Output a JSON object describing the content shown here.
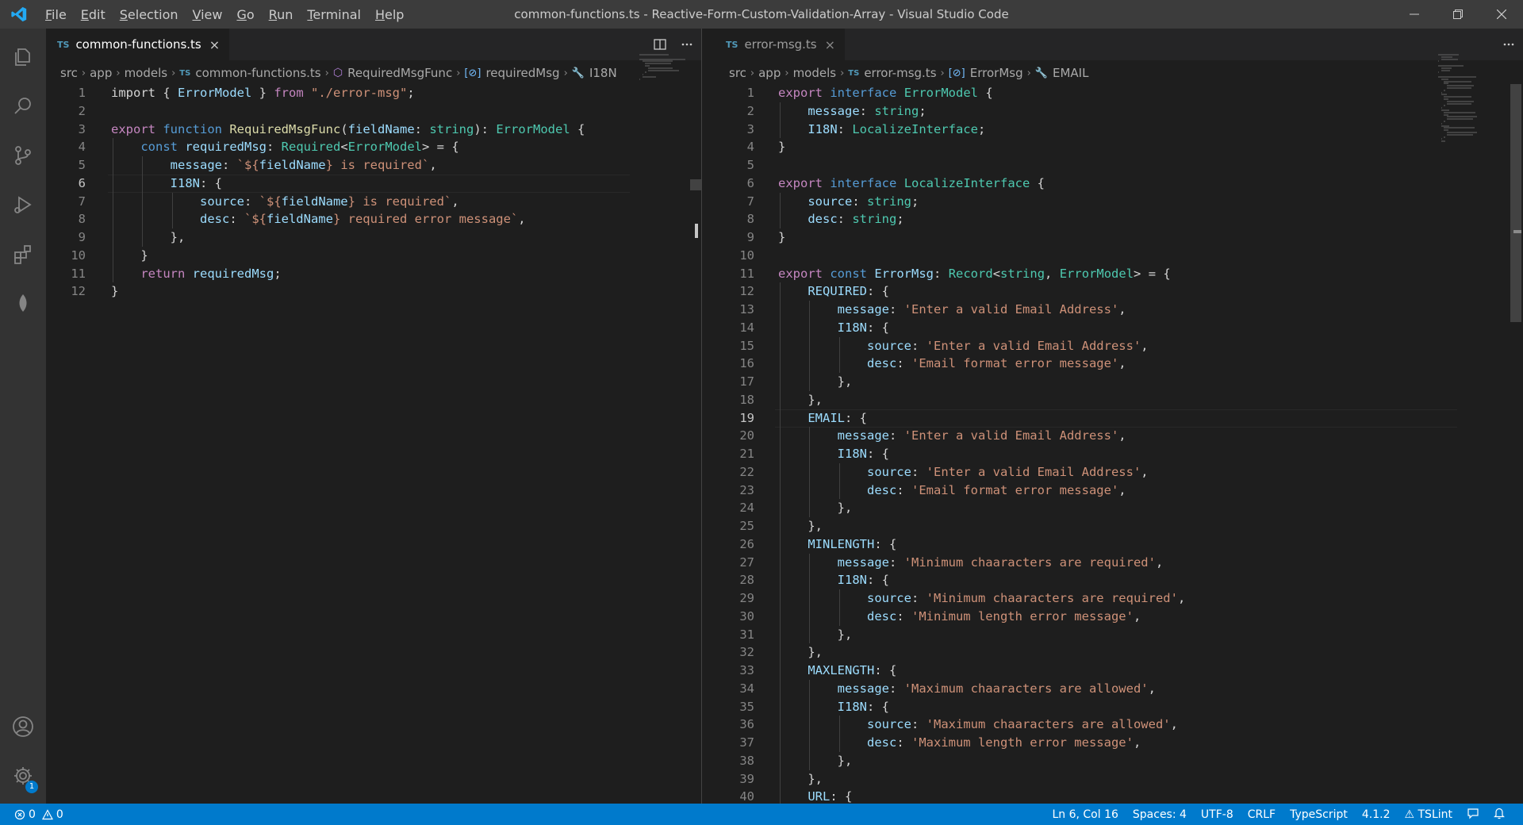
{
  "window": {
    "title": "common-functions.ts - Reactive-Form-Custom-Validation-Array - Visual Studio Code",
    "menu": [
      "File",
      "Edit",
      "Selection",
      "View",
      "Go",
      "Run",
      "Terminal",
      "Help"
    ]
  },
  "activity": {
    "items": [
      "explorer-icon",
      "search-icon",
      "source-control-icon",
      "run-debug-icon",
      "extensions-icon",
      "mongodb-leaf-icon"
    ],
    "bottom": [
      "account-icon",
      "settings-gear-icon"
    ],
    "settings_badge": "1"
  },
  "left_editor": {
    "tab": {
      "badge": "TS",
      "label": "common-functions.ts",
      "close": "×"
    },
    "actions": [
      "split-editor-icon",
      "more-actions-icon"
    ],
    "breadcrumb": [
      "src",
      "app",
      "models",
      "common-functions.ts",
      "RequiredMsgFunc",
      "requiredMsg",
      "I18N"
    ],
    "current_line": "6",
    "lines": [
      {
        "n": "1",
        "tokens": [
          [
            "pu",
            "import { "
          ],
          [
            "va",
            "ErrorModel"
          ],
          [
            "pu",
            " } "
          ],
          [
            "kc",
            "from"
          ],
          [
            "pu",
            " "
          ],
          [
            "st",
            "\"./error-msg\""
          ],
          [
            "pu",
            ";"
          ]
        ]
      },
      {
        "n": "2",
        "tokens": []
      },
      {
        "n": "3",
        "tokens": [
          [
            "kc",
            "export"
          ],
          [
            "pu",
            " "
          ],
          [
            "kw",
            "function"
          ],
          [
            "pu",
            " "
          ],
          [
            "fn",
            "RequiredMsgFunc"
          ],
          [
            "pu",
            "("
          ],
          [
            "va",
            "fieldName"
          ],
          [
            "pu",
            ": "
          ],
          [
            "ty",
            "string"
          ],
          [
            "pu",
            "): "
          ],
          [
            "ty",
            "ErrorModel"
          ],
          [
            "pu",
            " {"
          ]
        ]
      },
      {
        "n": "4",
        "tokens": [
          [
            "pu",
            "    "
          ],
          [
            "kw",
            "const"
          ],
          [
            "pu",
            " "
          ],
          [
            "va",
            "requiredMsg"
          ],
          [
            "pu",
            ": "
          ],
          [
            "ty",
            "Required"
          ],
          [
            "pu",
            "<"
          ],
          [
            "ty",
            "ErrorModel"
          ],
          [
            "pu",
            "> = {"
          ]
        ]
      },
      {
        "n": "5",
        "tokens": [
          [
            "pu",
            "        "
          ],
          [
            "va",
            "message"
          ],
          [
            "pu",
            ": "
          ],
          [
            "st",
            "`${"
          ],
          [
            "va",
            "fieldName"
          ],
          [
            "st",
            "} is required`"
          ],
          [
            "pu",
            ","
          ]
        ]
      },
      {
        "n": "6",
        "tokens": [
          [
            "pu",
            "        "
          ],
          [
            "va",
            "I18N"
          ],
          [
            "pu",
            ": {"
          ]
        ]
      },
      {
        "n": "7",
        "tokens": [
          [
            "pu",
            "            "
          ],
          [
            "va",
            "source"
          ],
          [
            "pu",
            ": "
          ],
          [
            "st",
            "`${"
          ],
          [
            "va",
            "fieldName"
          ],
          [
            "st",
            "} is required`"
          ],
          [
            "pu",
            ","
          ]
        ]
      },
      {
        "n": "8",
        "tokens": [
          [
            "pu",
            "            "
          ],
          [
            "va",
            "desc"
          ],
          [
            "pu",
            ": "
          ],
          [
            "st",
            "`${"
          ],
          [
            "va",
            "fieldName"
          ],
          [
            "st",
            "} required error message`"
          ],
          [
            "pu",
            ","
          ]
        ]
      },
      {
        "n": "9",
        "tokens": [
          [
            "pu",
            "        },"
          ]
        ]
      },
      {
        "n": "10",
        "tokens": [
          [
            "pu",
            "    }"
          ]
        ]
      },
      {
        "n": "11",
        "tokens": [
          [
            "pu",
            "    "
          ],
          [
            "kc",
            "return"
          ],
          [
            "pu",
            " "
          ],
          [
            "va",
            "requiredMsg"
          ],
          [
            "pu",
            ";"
          ]
        ]
      },
      {
        "n": "12",
        "tokens": [
          [
            "pu",
            "}"
          ]
        ]
      }
    ]
  },
  "right_editor": {
    "tab": {
      "badge": "TS",
      "label": "error-msg.ts",
      "close": "×"
    },
    "actions": [
      "more-actions-icon"
    ],
    "breadcrumb": [
      "src",
      "app",
      "models",
      "error-msg.ts",
      "ErrorMsg",
      "EMAIL"
    ],
    "current_line": "19",
    "lines": [
      {
        "n": "1",
        "tokens": [
          [
            "kc",
            "export"
          ],
          [
            "pu",
            " "
          ],
          [
            "kw",
            "interface"
          ],
          [
            "pu",
            " "
          ],
          [
            "ty",
            "ErrorModel"
          ],
          [
            "pu",
            " {"
          ]
        ]
      },
      {
        "n": "2",
        "tokens": [
          [
            "pu",
            "    "
          ],
          [
            "va",
            "message"
          ],
          [
            "pu",
            ": "
          ],
          [
            "ty",
            "string"
          ],
          [
            "pu",
            ";"
          ]
        ]
      },
      {
        "n": "3",
        "tokens": [
          [
            "pu",
            "    "
          ],
          [
            "va",
            "I18N"
          ],
          [
            "pu",
            ": "
          ],
          [
            "ty",
            "LocalizeInterface"
          ],
          [
            "pu",
            ";"
          ]
        ]
      },
      {
        "n": "4",
        "tokens": [
          [
            "pu",
            "}"
          ]
        ]
      },
      {
        "n": "5",
        "tokens": []
      },
      {
        "n": "6",
        "tokens": [
          [
            "kc",
            "export"
          ],
          [
            "pu",
            " "
          ],
          [
            "kw",
            "interface"
          ],
          [
            "pu",
            " "
          ],
          [
            "ty",
            "LocalizeInterface"
          ],
          [
            "pu",
            " {"
          ]
        ]
      },
      {
        "n": "7",
        "tokens": [
          [
            "pu",
            "    "
          ],
          [
            "va",
            "source"
          ],
          [
            "pu",
            ": "
          ],
          [
            "ty",
            "string"
          ],
          [
            "pu",
            ";"
          ]
        ]
      },
      {
        "n": "8",
        "tokens": [
          [
            "pu",
            "    "
          ],
          [
            "va",
            "desc"
          ],
          [
            "pu",
            ": "
          ],
          [
            "ty",
            "string"
          ],
          [
            "pu",
            ";"
          ]
        ]
      },
      {
        "n": "9",
        "tokens": [
          [
            "pu",
            "}"
          ]
        ]
      },
      {
        "n": "10",
        "tokens": []
      },
      {
        "n": "11",
        "tokens": [
          [
            "kc",
            "export"
          ],
          [
            "pu",
            " "
          ],
          [
            "kw",
            "const"
          ],
          [
            "pu",
            " "
          ],
          [
            "va",
            "ErrorMsg"
          ],
          [
            "pu",
            ": "
          ],
          [
            "ty",
            "Record"
          ],
          [
            "pu",
            "<"
          ],
          [
            "ty",
            "string"
          ],
          [
            "pu",
            ", "
          ],
          [
            "ty",
            "ErrorModel"
          ],
          [
            "pu",
            "> = {"
          ]
        ]
      },
      {
        "n": "12",
        "tokens": [
          [
            "pu",
            "    "
          ],
          [
            "va",
            "REQUIRED"
          ],
          [
            "pu",
            ": {"
          ]
        ]
      },
      {
        "n": "13",
        "tokens": [
          [
            "pu",
            "        "
          ],
          [
            "va",
            "message"
          ],
          [
            "pu",
            ": "
          ],
          [
            "st",
            "'Enter a valid Email Address'"
          ],
          [
            "pu",
            ","
          ]
        ]
      },
      {
        "n": "14",
        "tokens": [
          [
            "pu",
            "        "
          ],
          [
            "va",
            "I18N"
          ],
          [
            "pu",
            ": {"
          ]
        ]
      },
      {
        "n": "15",
        "tokens": [
          [
            "pu",
            "            "
          ],
          [
            "va",
            "source"
          ],
          [
            "pu",
            ": "
          ],
          [
            "st",
            "'Enter a valid Email Address'"
          ],
          [
            "pu",
            ","
          ]
        ]
      },
      {
        "n": "16",
        "tokens": [
          [
            "pu",
            "            "
          ],
          [
            "va",
            "desc"
          ],
          [
            "pu",
            ": "
          ],
          [
            "st",
            "'Email format error message'"
          ],
          [
            "pu",
            ","
          ]
        ]
      },
      {
        "n": "17",
        "tokens": [
          [
            "pu",
            "        },"
          ]
        ]
      },
      {
        "n": "18",
        "tokens": [
          [
            "pu",
            "    },"
          ]
        ]
      },
      {
        "n": "19",
        "tokens": [
          [
            "pu",
            "    "
          ],
          [
            "va",
            "EMAIL"
          ],
          [
            "pu",
            ": {"
          ]
        ]
      },
      {
        "n": "20",
        "tokens": [
          [
            "pu",
            "        "
          ],
          [
            "va",
            "message"
          ],
          [
            "pu",
            ": "
          ],
          [
            "st",
            "'Enter a valid Email Address'"
          ],
          [
            "pu",
            ","
          ]
        ]
      },
      {
        "n": "21",
        "tokens": [
          [
            "pu",
            "        "
          ],
          [
            "va",
            "I18N"
          ],
          [
            "pu",
            ": {"
          ]
        ]
      },
      {
        "n": "22",
        "tokens": [
          [
            "pu",
            "            "
          ],
          [
            "va",
            "source"
          ],
          [
            "pu",
            ": "
          ],
          [
            "st",
            "'Enter a valid Email Address'"
          ],
          [
            "pu",
            ","
          ]
        ]
      },
      {
        "n": "23",
        "tokens": [
          [
            "pu",
            "            "
          ],
          [
            "va",
            "desc"
          ],
          [
            "pu",
            ": "
          ],
          [
            "st",
            "'Email format error message'"
          ],
          [
            "pu",
            ","
          ]
        ]
      },
      {
        "n": "24",
        "tokens": [
          [
            "pu",
            "        },"
          ]
        ]
      },
      {
        "n": "25",
        "tokens": [
          [
            "pu",
            "    },"
          ]
        ]
      },
      {
        "n": "26",
        "tokens": [
          [
            "pu",
            "    "
          ],
          [
            "va",
            "MINLENGTH"
          ],
          [
            "pu",
            ": {"
          ]
        ]
      },
      {
        "n": "27",
        "tokens": [
          [
            "pu",
            "        "
          ],
          [
            "va",
            "message"
          ],
          [
            "pu",
            ": "
          ],
          [
            "st",
            "'Minimum chaaracters are required'"
          ],
          [
            "pu",
            ","
          ]
        ]
      },
      {
        "n": "28",
        "tokens": [
          [
            "pu",
            "        "
          ],
          [
            "va",
            "I18N"
          ],
          [
            "pu",
            ": {"
          ]
        ]
      },
      {
        "n": "29",
        "tokens": [
          [
            "pu",
            "            "
          ],
          [
            "va",
            "source"
          ],
          [
            "pu",
            ": "
          ],
          [
            "st",
            "'Minimum chaaracters are required'"
          ],
          [
            "pu",
            ","
          ]
        ]
      },
      {
        "n": "30",
        "tokens": [
          [
            "pu",
            "            "
          ],
          [
            "va",
            "desc"
          ],
          [
            "pu",
            ": "
          ],
          [
            "st",
            "'Minimum length error message'"
          ],
          [
            "pu",
            ","
          ]
        ]
      },
      {
        "n": "31",
        "tokens": [
          [
            "pu",
            "        },"
          ]
        ]
      },
      {
        "n": "32",
        "tokens": [
          [
            "pu",
            "    },"
          ]
        ]
      },
      {
        "n": "33",
        "tokens": [
          [
            "pu",
            "    "
          ],
          [
            "va",
            "MAXLENGTH"
          ],
          [
            "pu",
            ": {"
          ]
        ]
      },
      {
        "n": "34",
        "tokens": [
          [
            "pu",
            "        "
          ],
          [
            "va",
            "message"
          ],
          [
            "pu",
            ": "
          ],
          [
            "st",
            "'Maximum chaaracters are allowed'"
          ],
          [
            "pu",
            ","
          ]
        ]
      },
      {
        "n": "35",
        "tokens": [
          [
            "pu",
            "        "
          ],
          [
            "va",
            "I18N"
          ],
          [
            "pu",
            ": {"
          ]
        ]
      },
      {
        "n": "36",
        "tokens": [
          [
            "pu",
            "            "
          ],
          [
            "va",
            "source"
          ],
          [
            "pu",
            ": "
          ],
          [
            "st",
            "'Maximum chaaracters are allowed'"
          ],
          [
            "pu",
            ","
          ]
        ]
      },
      {
        "n": "37",
        "tokens": [
          [
            "pu",
            "            "
          ],
          [
            "va",
            "desc"
          ],
          [
            "pu",
            ": "
          ],
          [
            "st",
            "'Maximum length error message'"
          ],
          [
            "pu",
            ","
          ]
        ]
      },
      {
        "n": "38",
        "tokens": [
          [
            "pu",
            "        },"
          ]
        ]
      },
      {
        "n": "39",
        "tokens": [
          [
            "pu",
            "    },"
          ]
        ]
      },
      {
        "n": "40",
        "tokens": [
          [
            "pu",
            "    "
          ],
          [
            "va",
            "URL"
          ],
          [
            "pu",
            ": {"
          ]
        ]
      }
    ]
  },
  "status": {
    "errors": "0",
    "warnings": "0",
    "right": [
      "Ln 6, Col 16",
      "Spaces: 4",
      "UTF-8",
      "CRLF",
      "TypeScript",
      "4.1.2",
      "TSLint"
    ]
  },
  "colors": {
    "accent": "#007acc",
    "keyword": "#569cd6",
    "control": "#c586c0",
    "type": "#4ec9b0",
    "function": "#dcdcaa",
    "variable": "#9cdcfe",
    "string": "#ce9178"
  }
}
